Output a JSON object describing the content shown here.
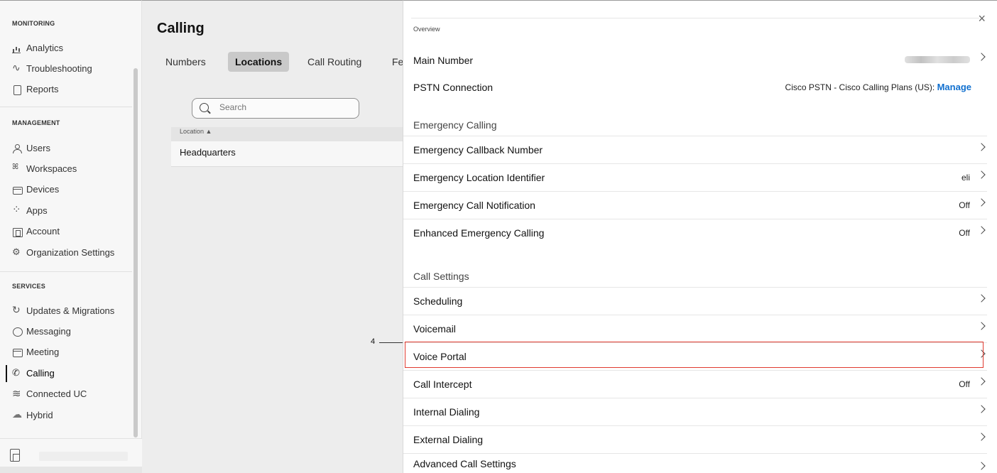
{
  "sidebar": {
    "sections": {
      "monitoring": "MONITORING",
      "management": "MANAGEMENT",
      "services": "SERVICES"
    },
    "monitoring_items": [
      {
        "label": "Analytics",
        "icon": "bar-chart-icon"
      },
      {
        "label": "Troubleshooting",
        "icon": "pulse-icon"
      },
      {
        "label": "Reports",
        "icon": "report-icon"
      }
    ],
    "management_items": [
      {
        "label": "Users",
        "icon": "user-icon"
      },
      {
        "label": "Workspaces",
        "icon": "workspaces-icon"
      },
      {
        "label": "Devices",
        "icon": "device-icon"
      },
      {
        "label": "Apps",
        "icon": "apps-icon"
      },
      {
        "label": "Account",
        "icon": "account-icon"
      },
      {
        "label": "Organization Settings",
        "icon": "gear-icon"
      }
    ],
    "services_items": [
      {
        "label": "Updates & Migrations",
        "icon": "refresh-icon"
      },
      {
        "label": "Messaging",
        "icon": "message-icon"
      },
      {
        "label": "Meeting",
        "icon": "meeting-icon"
      },
      {
        "label": "Calling",
        "icon": "phone-icon",
        "active": true
      },
      {
        "label": "Connected UC",
        "icon": "connected-uc-icon"
      },
      {
        "label": "Hybrid",
        "icon": "cloud-icon"
      }
    ]
  },
  "main": {
    "title": "Calling",
    "tabs": [
      {
        "label": "Numbers"
      },
      {
        "label": "Locations",
        "active": true
      },
      {
        "label": "Call Routing"
      },
      {
        "label": "Fe"
      }
    ],
    "search_placeholder": "Search",
    "table": {
      "header": "Location ▲",
      "rows": [
        "Headquarters"
      ]
    },
    "callout": "4"
  },
  "panel": {
    "close": "×",
    "overview": "Overview",
    "main_number": "Main Number",
    "pstn_connection": "PSTN Connection",
    "pstn_value": "Cisco PSTN - Cisco Calling Plans (US): ",
    "pstn_manage": "Manage",
    "emergency_head": "Emergency Calling",
    "emergency_rows": [
      {
        "label": "Emergency Callback Number",
        "value": ""
      },
      {
        "label": "Emergency Location Identifier",
        "value": "eli"
      },
      {
        "label": "Emergency Call Notification",
        "value": "Off"
      },
      {
        "label": "Enhanced Emergency Calling",
        "value": "Off"
      }
    ],
    "call_settings_head": "Call Settings",
    "call_settings_rows": [
      {
        "label": "Scheduling",
        "value": ""
      },
      {
        "label": "Voicemail",
        "value": ""
      },
      {
        "label": "Voice Portal",
        "value": ""
      },
      {
        "label": "Call Intercept",
        "value": "Off"
      },
      {
        "label": "Internal Dialing",
        "value": ""
      },
      {
        "label": "External Dialing",
        "value": ""
      },
      {
        "label": "Advanced Call Settings",
        "value": ""
      }
    ]
  }
}
